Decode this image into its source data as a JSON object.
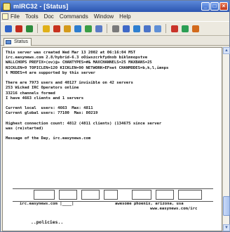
{
  "window": {
    "title": "mIRC32 - [Status]",
    "controls": [
      "_",
      "□",
      "×"
    ]
  },
  "menubar": {
    "items": [
      "File",
      "Tools",
      "Doc",
      "Commands",
      "Window",
      "Help"
    ]
  },
  "toolbar": {
    "icons": [
      {
        "name": "connect-icon",
        "color": "#2f63c8"
      },
      {
        "name": "disconnect-icon",
        "color": "#c22a1d"
      },
      {
        "name": "options-icon",
        "color": "#2c8c3c"
      },
      {
        "name": "favorites-icon",
        "color": "#e0b018"
      },
      {
        "name": "channel-list-icon",
        "color": "#c8331f"
      },
      {
        "name": "address-book-icon",
        "color": "#d49a1a"
      },
      {
        "name": "send-file-icon",
        "color": "#2c7dcf"
      },
      {
        "name": "received-files-icon",
        "color": "#3a9e45"
      },
      {
        "name": "dcc-chat-icon",
        "color": "#5a7bc6"
      },
      {
        "name": "notify-icon",
        "color": "#7a7a7a"
      },
      {
        "name": "url-list-icon",
        "color": "#3f69c7"
      },
      {
        "name": "tile-icon",
        "color": "#2e7fd0"
      },
      {
        "name": "cascade-icon",
        "color": "#4a74c8"
      },
      {
        "name": "arrange-icon",
        "color": "#5f8fd6"
      },
      {
        "name": "timer-icon",
        "color": "#c9342a"
      },
      {
        "name": "colors-icon",
        "color": "#2b9e54"
      },
      {
        "name": "help-icon",
        "color": "#d26a1c"
      }
    ]
  },
  "tab": {
    "label": "Status"
  },
  "status_text": [
    "This server was created Wed Mar 13 2002 at 06:16:04 MST",
    "irc.easynews.com 2.8/hybrid-6.3 oOiwszcrkfydnxb biklmnopstve",
    "WALLCHOPS PREFIX=(ov)@+ CHANTYPES=#& MAXCHANNELS=25 MAXBANS=25",
    "NICKLEN=9 TOPICLEN=120 KICKLEN=90 NETWORK=EFnet CHANMODES=b,k,l,imnps",
    "t MODES=4 are supported by this server",
    "",
    "There are 7973 users and 40127 invisible on 42 servers",
    "253 Wicked IRC Operators online",
    "33216 channels formed",
    "I have 4663 clients and 1 servers",
    "",
    "Current local  users: 4663  Max: 4811",
    "Current global users: 77100  Max: 80219",
    "",
    "Highest connection count: 4812 (4811 clients) (134675 since server",
    "was (re)started)",
    "",
    "Message of the Day, irc.easynews.com"
  ],
  "motd": {
    "left_caption": "irc.easynews.com |____|",
    "right_caption": "awesome phoenix, arizona, usa",
    "url": "www.easynews.com/irc",
    "policies": "..policies.."
  }
}
